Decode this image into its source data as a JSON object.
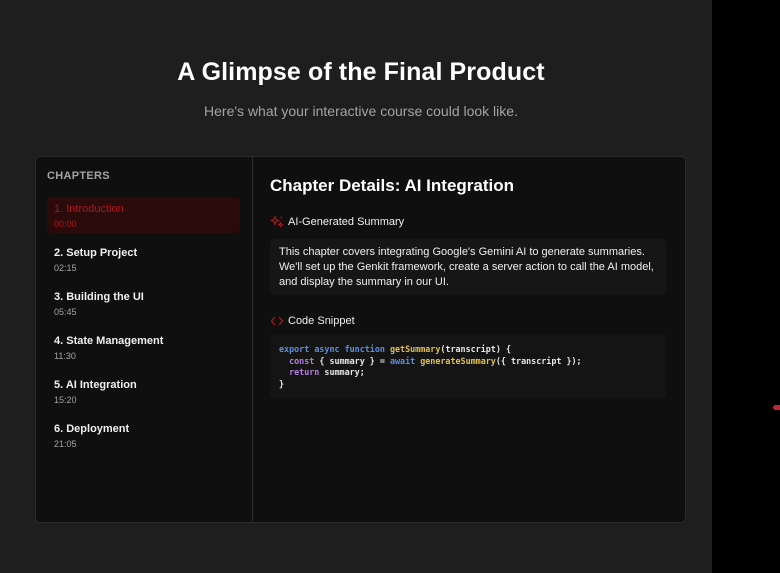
{
  "hero": {
    "title": "A Glimpse of the Final Product",
    "subtitle": "Here's what your interactive course could look like."
  },
  "sidebar": {
    "heading": "CHAPTERS",
    "chapters": [
      {
        "title": "1. Introduction",
        "time": "00:00",
        "active": true
      },
      {
        "title": "2. Setup Project",
        "time": "02:15",
        "active": false
      },
      {
        "title": "3. Building the UI",
        "time": "05:45",
        "active": false
      },
      {
        "title": "4. State Management",
        "time": "11:30",
        "active": false
      },
      {
        "title": "5. AI Integration",
        "time": "15:20",
        "active": false
      },
      {
        "title": "6. Deployment",
        "time": "21:05",
        "active": false
      }
    ]
  },
  "content": {
    "title": "Chapter Details: AI Integration",
    "summary_label": "AI-Generated Summary",
    "summary_icon": "sparkles-icon",
    "summary_text": "This chapter covers integrating Google's Gemini AI to generate summaries. We'll set up the Genkit framework, create a server action to call the AI model, and display the summary in our UI.",
    "code_label": "Code Snippet",
    "code_icon": "code-icon",
    "code": {
      "line1_kw1": "export",
      "line1_kw2": "async",
      "line1_kw3": "function",
      "line1_fn": "getSummary",
      "line1_rest": "(transcript) {",
      "line2_kw": "const",
      "line2_mid": " { summary } = ",
      "line2_kw2": "await",
      "line2_fn": "generateSummary",
      "line2_rest": "({ transcript });",
      "line3_kw": "return",
      "line3_rest": " summary;",
      "line4": "}"
    }
  },
  "colors": {
    "accent": "#b1161c",
    "background": "#1e1e1e",
    "panel": "#0f0f0f"
  }
}
